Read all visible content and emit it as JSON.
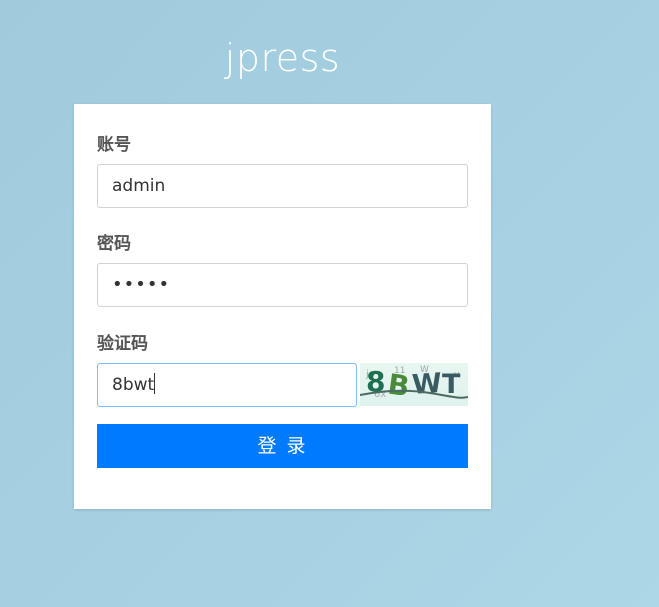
{
  "brand": {
    "title": "jpress"
  },
  "form": {
    "account_label": "账号",
    "account_value": "admin",
    "password_label": "密码",
    "password_value": "•••••",
    "captcha_label": "验证码",
    "captcha_value": "8bwt",
    "captcha_image_text": "8BWT",
    "submit_label": "登 录"
  },
  "colors": {
    "background": "#a5d0e2",
    "primary_button": "#007bff",
    "focus_border": "#80bdff"
  }
}
